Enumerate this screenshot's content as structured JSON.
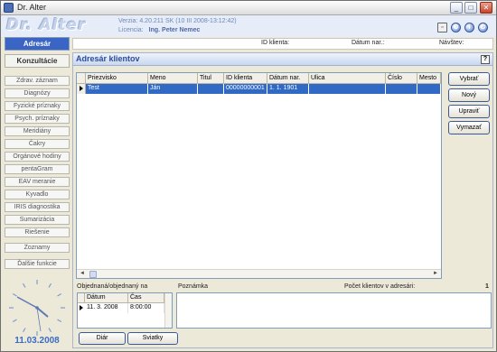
{
  "window": {
    "title": "Dr. Alter",
    "min": "_",
    "max": "□",
    "close": "✕"
  },
  "header": {
    "logo": "Dr. Alter",
    "version": "Verzia: 4.20.211 SK (10 III 2008-13:12:42)",
    "licence_label": "Licencia:",
    "licence_name": "Ing. Peter Nemec",
    "icons": [
      "window-icon",
      "settings-icon",
      "info-icon",
      "power-icon"
    ],
    "icon_glyphs": [
      "▫",
      "⚙",
      "i",
      "⏻"
    ]
  },
  "sidebar": {
    "main_tabs": [
      {
        "label": "Adresár",
        "active": true
      },
      {
        "label": "Konzultácie",
        "active": false
      }
    ],
    "items": [
      "Zdrav. záznam",
      "Diagnózy",
      "Fyzické príznaky",
      "Psych. príznaky",
      "Meridiány",
      "Čakry",
      "Orgánové hodiny",
      "pentaGram",
      "EAV meranie",
      "Kyvadlo",
      "IRIS diagnostika",
      "Sumarizácia",
      "Riešenie",
      "Zoznamy",
      "Ďalšie funkcie"
    ],
    "date": "11.03.2008"
  },
  "infobar": {
    "client_id_label": "ID klienta:",
    "birth_label": "Dátum nar.:",
    "visit_label": "Návštev:"
  },
  "panel": {
    "title": "Adresár klientov",
    "help": "?",
    "columns": [
      "Priezvisko",
      "Meno",
      "Titul",
      "ID klienta",
      "Dátum nar.",
      "Ulica",
      "Číslo",
      "Mesto"
    ],
    "rows": [
      [
        "Test",
        "Ján",
        "",
        "00000000001",
        "1. 1. 1901",
        "",
        "",
        ""
      ]
    ],
    "side_buttons": [
      "Vybrať",
      "Nový",
      "Upraviť",
      "Vymazať"
    ],
    "orders_label": "Objednaná/objednaný na",
    "orders_columns": [
      "Dátum",
      "Čas"
    ],
    "orders_rows": [
      [
        "11. 3. 2008",
        "8:00:00"
      ]
    ],
    "note_label": "Poznámka",
    "count_label": "Počet klientov v adresári:",
    "count_value": "1",
    "bottom_buttons": [
      "Diár",
      "Sviatky"
    ]
  },
  "colors": {
    "accent": "#3a65c5",
    "selection": "#316ac5",
    "panel_title": "#2c4e9a",
    "date": "#3c6bc8"
  }
}
